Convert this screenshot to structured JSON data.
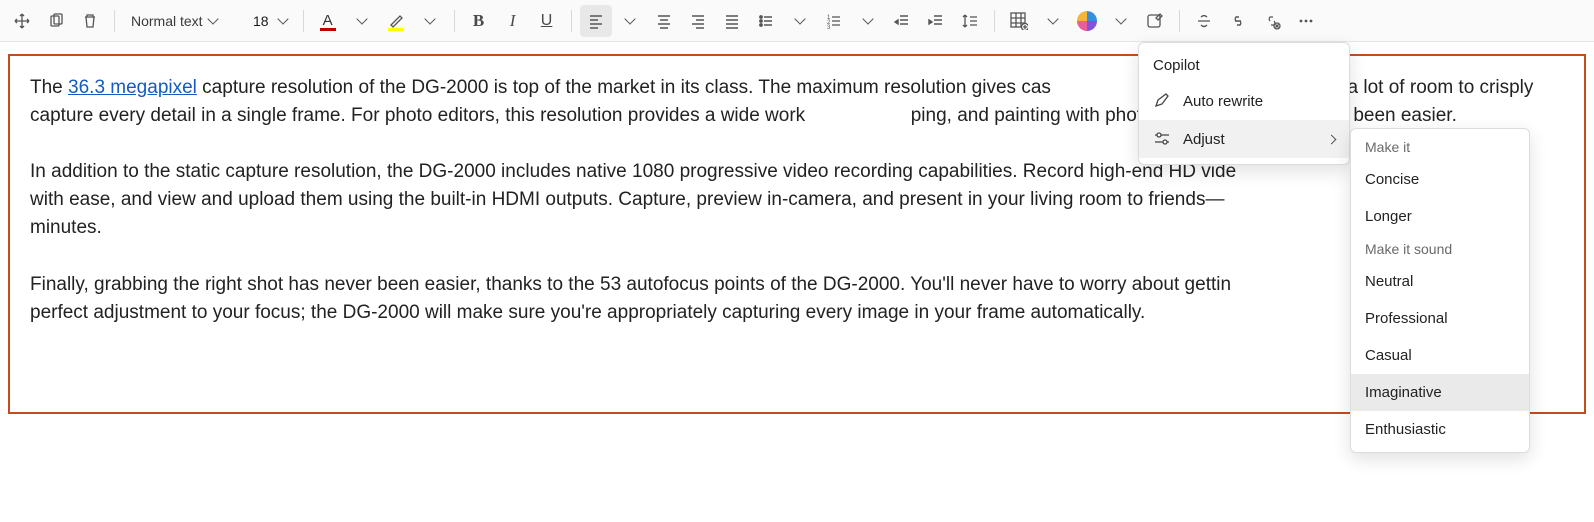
{
  "toolbar": {
    "style_select": "Normal text",
    "font_size": "18"
  },
  "document": {
    "p1_pre": "The ",
    "p1_link": "36.3 megapixel",
    "p1_post": " capture resolution of the DG-2000 is top of the market in its class. The maximum resolution gives cas",
    "p1_tail": "l pros alike a lot of room to crisply capture every detail in a single frame. For photo editors, this resolution provides a wide work",
    "p1_tail2": "ping, and painting with photo editing tools has never been easier.",
    "p2a": "In addition to the static capture resolution, the DG-2000 includes native 1080 progressive video recording capabilities. Record high-end HD vide",
    "p2b": "with ease, and view and upload them using the built-in HDMI outputs. Capture, preview in-camera, and present in your living room to friends—",
    "p2c": "minutes.",
    "p3a": "Finally, grabbing the right shot has never been easier, thanks to the 53 autofocus points of the DG-2000. You'll never have to worry about gettin",
    "p3b": "perfect adjustment to your focus; the DG-2000 will make sure you're appropriately capturing every image in your frame automatically."
  },
  "copilot_menu": {
    "title": "Copilot",
    "auto_rewrite": "Auto rewrite",
    "adjust": "Adjust"
  },
  "adjust_menu": {
    "header1": "Make it",
    "concise": "Concise",
    "longer": "Longer",
    "header2": "Make it sound",
    "neutral": "Neutral",
    "professional": "Professional",
    "casual": "Casual",
    "imaginative": "Imaginative",
    "enthusiastic": "Enthusiastic"
  }
}
